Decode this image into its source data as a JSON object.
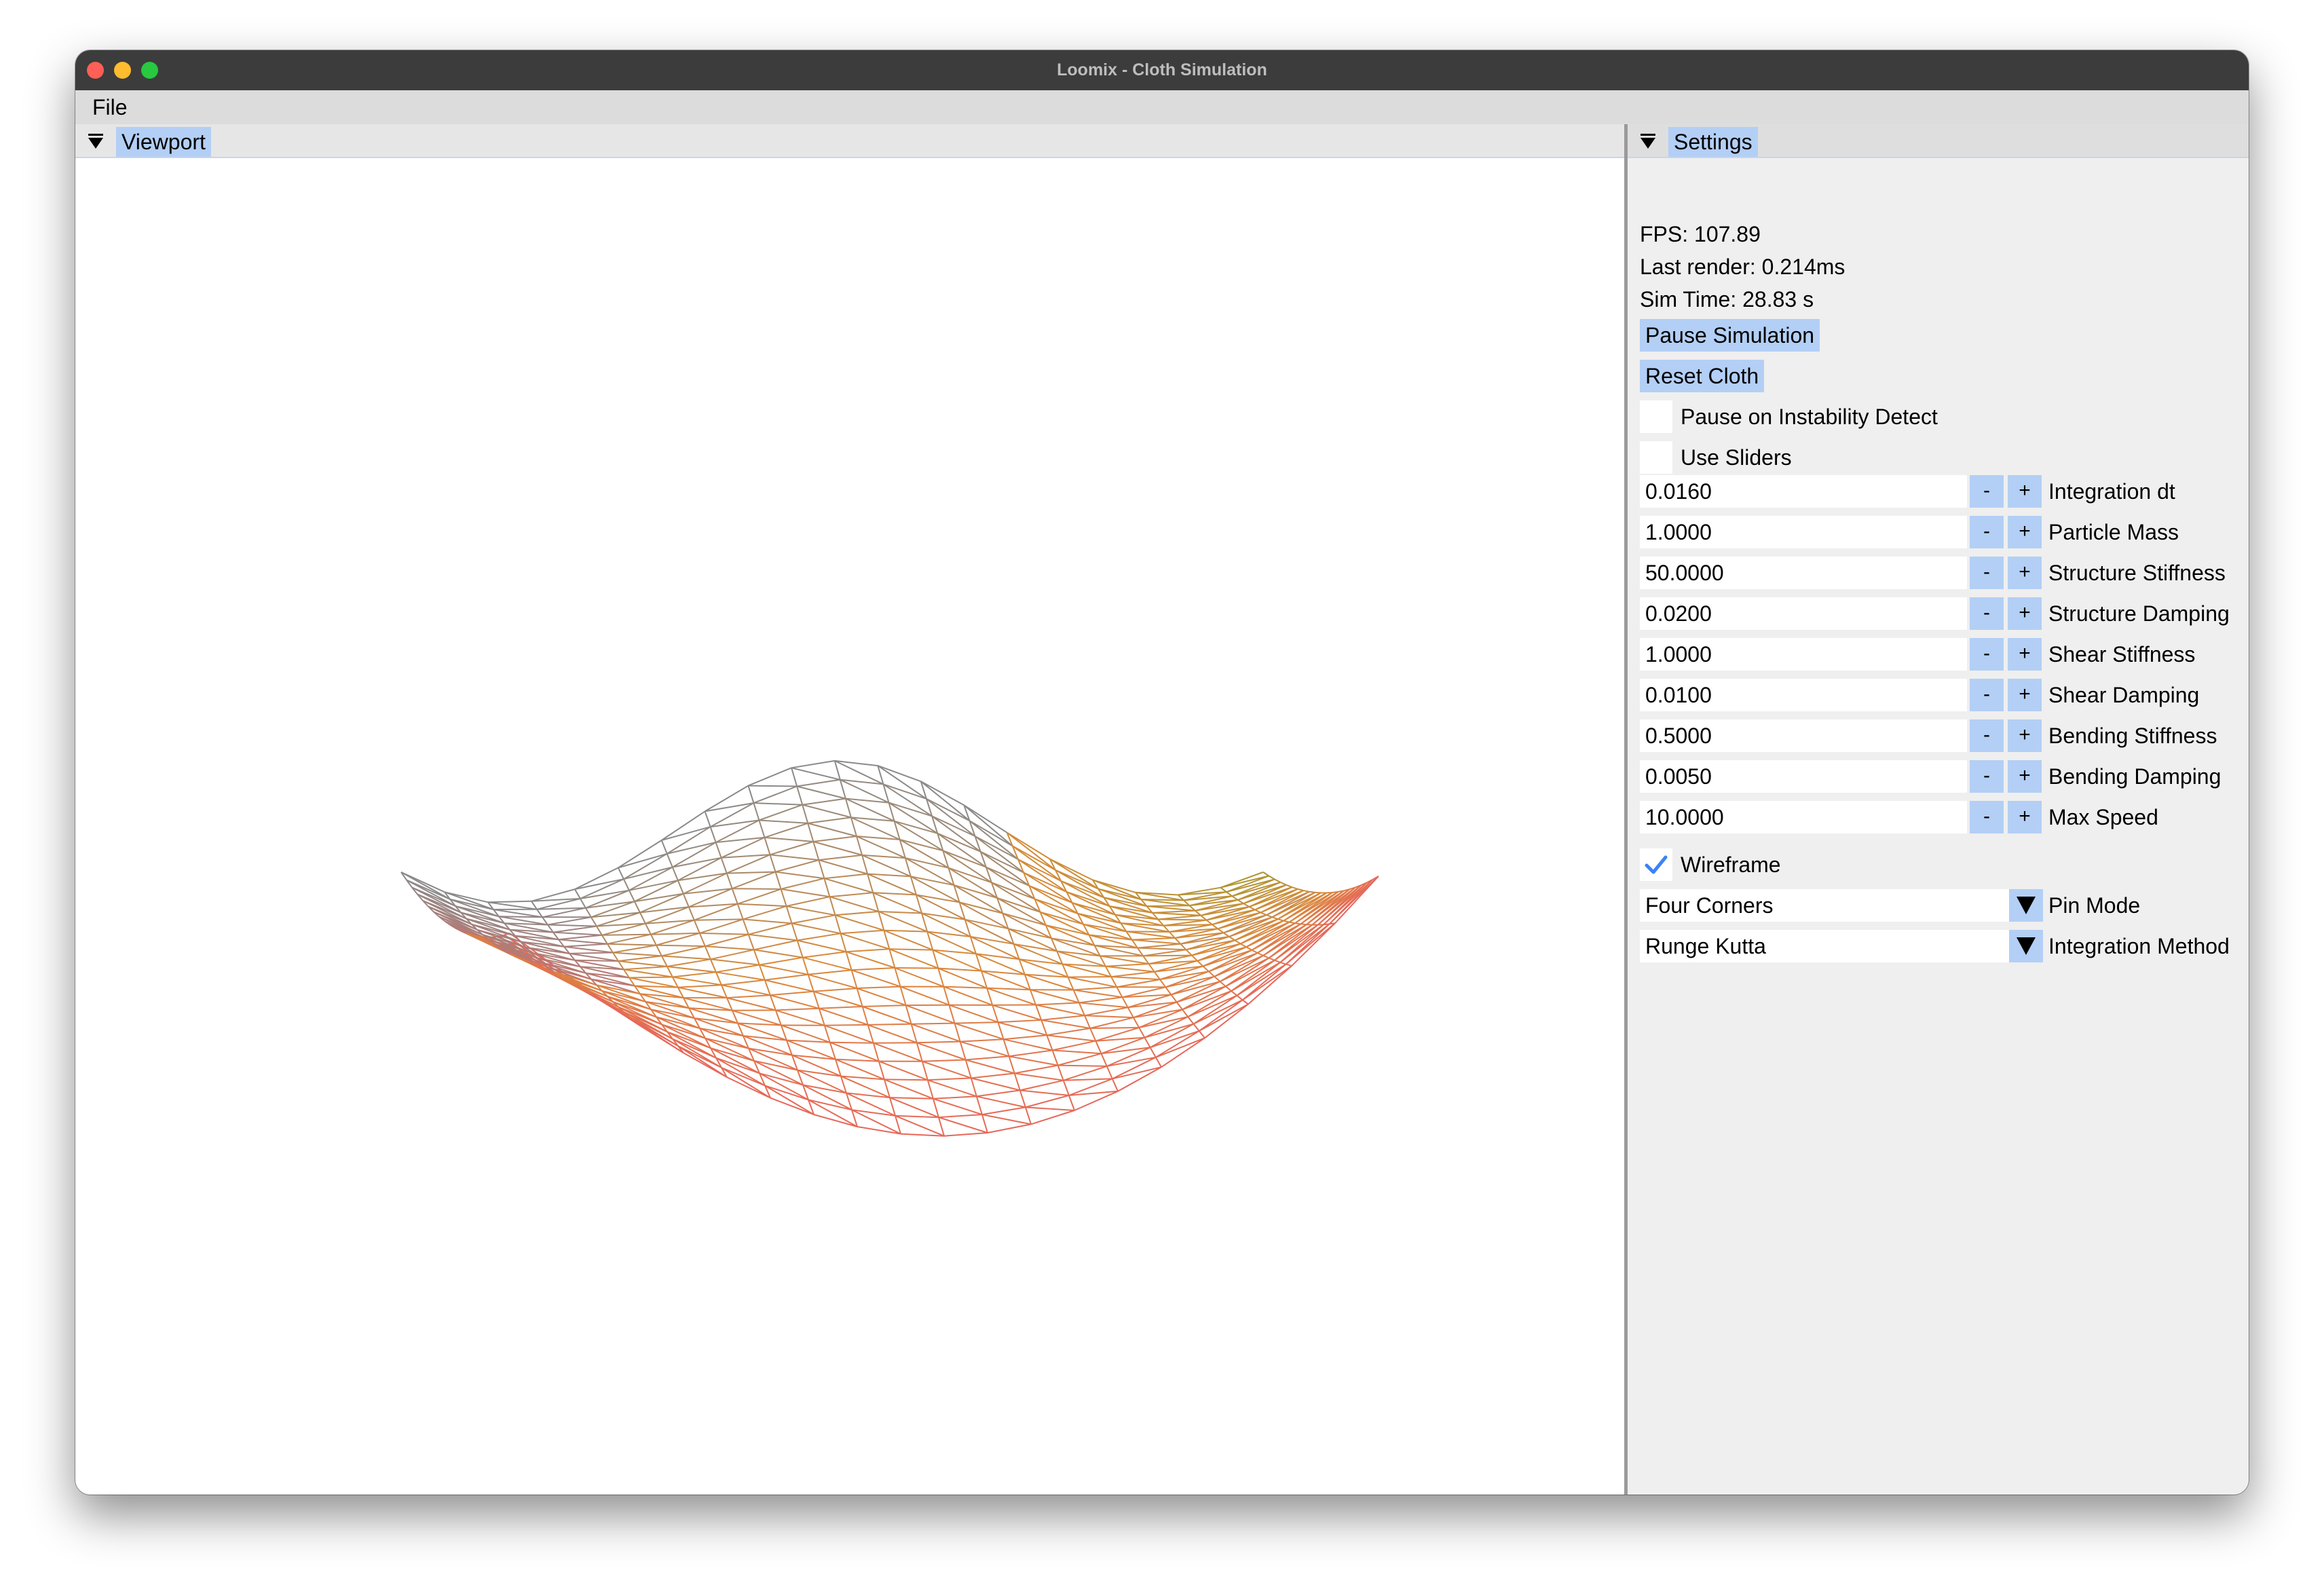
{
  "window": {
    "title": "Loomix - Cloth Simulation"
  },
  "menu": {
    "file": "File"
  },
  "viewport": {
    "tab_label": "Viewport"
  },
  "settings": {
    "tab_label": "Settings",
    "fps": "FPS: 107.89",
    "last_render": "Last render: 0.214ms",
    "sim_time": "Sim Time: 28.83 s",
    "pause_button": "Pause Simulation",
    "reset_button": "Reset Cloth",
    "checkboxes": [
      {
        "label": "Pause on Instability Detect",
        "checked": false
      },
      {
        "label": "Use Sliders",
        "checked": false
      }
    ],
    "params": [
      {
        "value": "0.0160",
        "label": "Integration dt"
      },
      {
        "value": "1.0000",
        "label": "Particle Mass"
      },
      {
        "value": "50.0000",
        "label": "Structure Stiffness"
      },
      {
        "value": "0.0200",
        "label": "Structure Damping"
      },
      {
        "value": "1.0000",
        "label": "Shear Stiffness"
      },
      {
        "value": "0.0100",
        "label": "Shear Damping"
      },
      {
        "value": "0.5000",
        "label": "Bending Stiffness"
      },
      {
        "value": "0.0050",
        "label": "Bending Damping"
      },
      {
        "value": "10.0000",
        "label": "Max Speed"
      }
    ],
    "minus_label": "-",
    "plus_label": "+",
    "wireframe": {
      "label": "Wireframe",
      "checked": true
    },
    "pin_mode": {
      "value": "Four Corners",
      "label": "Pin Mode"
    },
    "integration_method": {
      "value": "Runge Kutta",
      "label": "Integration Method"
    }
  },
  "colors": {
    "titlebar": "#3c3c3c",
    "menubar": "#dcdcdc",
    "accent": "#b3cff5",
    "check": "#3b82f6",
    "cloth_front": "#e8665a",
    "cloth_mid": "#d88a3a",
    "cloth_back": "#8a8a8a",
    "cloth_olive": "#9a9a30"
  }
}
